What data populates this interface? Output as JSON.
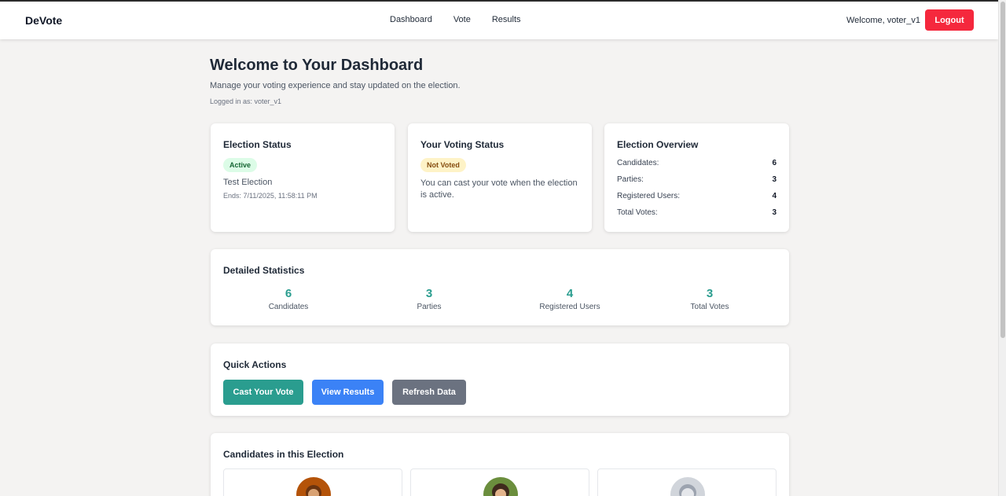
{
  "app": {
    "brand": "DeVote"
  },
  "nav": {
    "items": [
      "Dashboard",
      "Vote",
      "Results"
    ]
  },
  "header": {
    "welcome": "Welcome, voter_v1",
    "logout": "Logout"
  },
  "page": {
    "title": "Welcome to Your Dashboard",
    "subtitle": "Manage your voting experience and stay updated on the election.",
    "logged_in": "Logged in as: voter_v1"
  },
  "election_status": {
    "title": "Election Status",
    "badge": "Active",
    "name": "Test Election",
    "ends": "Ends: 7/11/2025, 11:58:11 PM"
  },
  "voting_status": {
    "title": "Your Voting Status",
    "badge": "Not Voted",
    "message": "You can cast your vote when the election is active."
  },
  "overview": {
    "title": "Election Overview",
    "rows": [
      {
        "label": "Candidates:",
        "value": "6"
      },
      {
        "label": "Parties:",
        "value": "3"
      },
      {
        "label": "Registered Users:",
        "value": "4"
      },
      {
        "label": "Total Votes:",
        "value": "3"
      }
    ]
  },
  "stats": {
    "title": "Detailed Statistics",
    "items": [
      {
        "value": "6",
        "label": "Candidates"
      },
      {
        "value": "3",
        "label": "Parties"
      },
      {
        "value": "4",
        "label": "Registered Users"
      },
      {
        "value": "3",
        "label": "Total Votes"
      }
    ]
  },
  "quick_actions": {
    "title": "Quick Actions",
    "buttons": [
      {
        "label": "Cast Your Vote",
        "color": "#2a9d8f"
      },
      {
        "label": "View Results",
        "color": "#3b82f6"
      },
      {
        "label": "Refresh Data",
        "color": "#6b7280"
      }
    ]
  },
  "candidates": {
    "title": "Candidates in this Election"
  },
  "colors": {
    "accent": "#2a9d8f",
    "logout": "#f5283d",
    "active_badge": "#dcfce7",
    "not_voted_badge": "#fef3c7"
  }
}
